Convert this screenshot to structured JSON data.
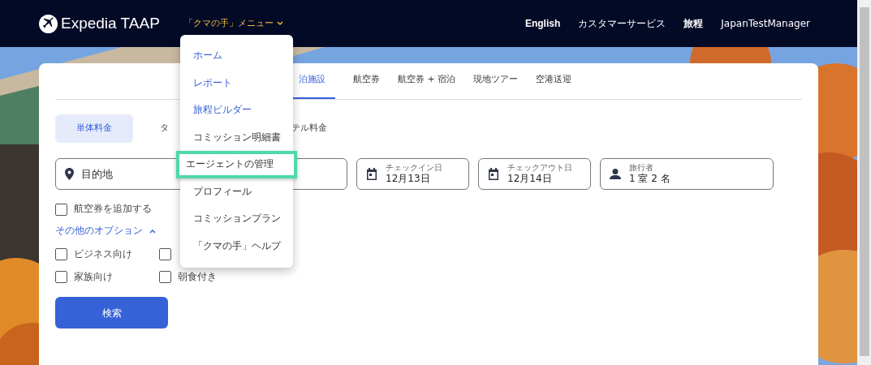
{
  "header": {
    "brand": "Expedia TAAP",
    "menu_button": "「クマの手」メニュー",
    "nav": [
      "English",
      "カスタマーサービス",
      "旅程",
      "JapanTestManager"
    ]
  },
  "menu": {
    "items": [
      {
        "label": "ホーム",
        "kind": "link",
        "highlighted": false
      },
      {
        "label": "レポート",
        "kind": "link",
        "highlighted": false
      },
      {
        "label": "旅程ビルダー",
        "kind": "link",
        "highlighted": false
      },
      {
        "label": "コミッション明細書",
        "kind": "item",
        "highlighted": false
      },
      {
        "label": "エージェントの管理",
        "kind": "item",
        "highlighted": true
      },
      {
        "label": "プロフィール",
        "kind": "item",
        "highlighted": false
      },
      {
        "label": "コミッションプラン",
        "kind": "item",
        "highlighted": false
      },
      {
        "label": "「クマの手」ヘルプ",
        "kind": "item",
        "highlighted": false
      }
    ]
  },
  "tabs": [
    {
      "label": "泊施設",
      "selected": true
    },
    {
      "label": "航空券",
      "selected": false
    },
    {
      "label": "航空券 + 宿泊",
      "selected": false
    },
    {
      "label": "現地ツアー",
      "selected": false
    },
    {
      "label": "空港送迎",
      "selected": false
    }
  ],
  "rate_toggle": [
    {
      "label": "単体料金",
      "selected": true
    },
    {
      "label": "タ",
      "selected": false
    },
    {
      "label": "テル料金",
      "selected": false
    }
  ],
  "destination": {
    "placeholder": "目的地"
  },
  "fields": [
    {
      "kind": "date",
      "label": "チェックイン日",
      "value": "12月13日"
    },
    {
      "kind": "date",
      "label": "チェックアウト日",
      "value": "12月14日"
    },
    {
      "kind": "person",
      "label": "旅行者",
      "value": "1 室 2 名"
    }
  ],
  "add_flight": {
    "label": "航空券を追加する",
    "checked": false
  },
  "more_options": {
    "label": "その他のオプション",
    "expanded": true
  },
  "options": [
    {
      "label": "ビジネス向け",
      "checked": false
    },
    {
      "checked": false
    },
    {
      "label": "家族向け",
      "checked": false
    },
    {
      "label": "朝食付き",
      "checked": false
    }
  ],
  "search_button": "検索"
}
